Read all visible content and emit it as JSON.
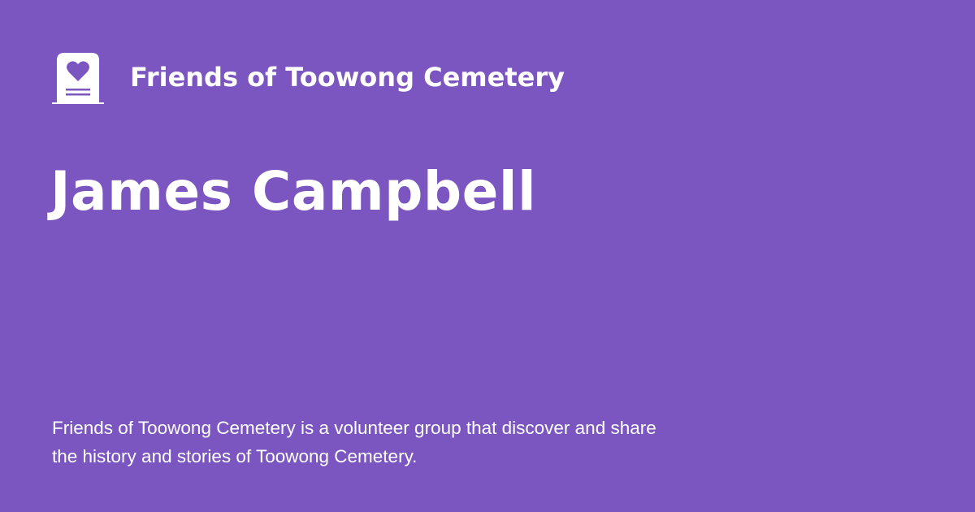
{
  "brand": {
    "logo_icon": "headstone-heart-icon",
    "name": "Friends of Toowong Cemetery"
  },
  "page": {
    "title": "James Campbell",
    "description": "Friends of Toowong Cemetery is a volunteer group that discover and share the history and stories of Toowong Cemetery."
  },
  "colors": {
    "background": "#7b56c0",
    "foreground": "#ffffff"
  }
}
